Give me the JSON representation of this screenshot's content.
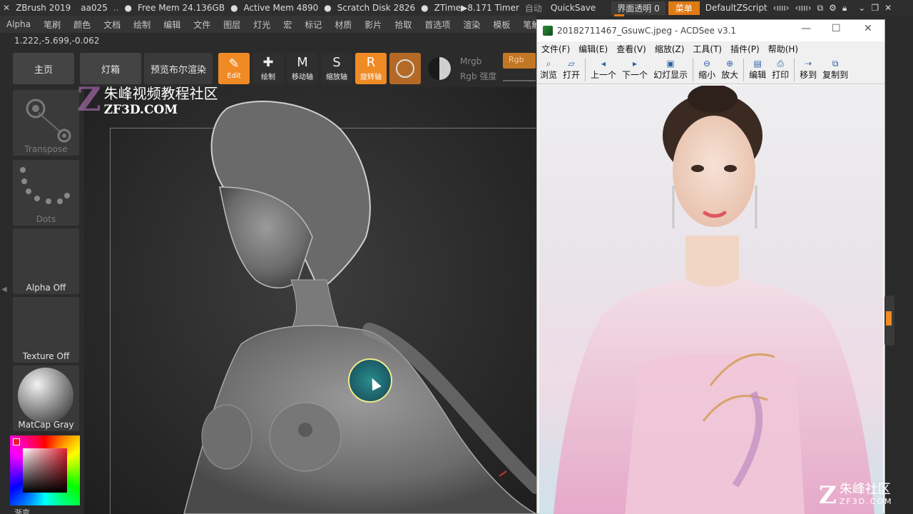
{
  "zbrush": {
    "title_bar": {
      "app": "ZBrush 2019",
      "doc": "aa025",
      "dots": "..",
      "free_mem": "Free Mem 24.136GB",
      "active_mem": "Active Mem 4890",
      "scratch_disk": "Scratch Disk 2826",
      "ztime": "ZTime▶8.171 Timer",
      "auto": "自动",
      "quicksave": "QuickSave",
      "ui_transparency": "界面透明 0",
      "menu_btn": "菜单",
      "script": "DefaultZScript"
    },
    "menu": [
      "Alpha",
      "笔刷",
      "颜色",
      "文档",
      "绘制",
      "编辑",
      "文件",
      "图层",
      "灯光",
      "宏",
      "标记",
      "材质",
      "影片",
      "拾取",
      "首选项",
      "渲染",
      "模板",
      "笔触",
      "纹"
    ],
    "coords": "1.222,-5.699,-0.062",
    "shelf": {
      "home": "主页",
      "lightbox": "灯箱",
      "bpr": "预览布尔渲染"
    },
    "tools": [
      {
        "label": "Edit",
        "icon": "edit-icon",
        "glyph": "✎"
      },
      {
        "label": "绘制",
        "icon": "draw-icon",
        "glyph": "✚"
      },
      {
        "label": "移动轴",
        "icon": "move-icon",
        "glyph": "M"
      },
      {
        "label": "缩放轴",
        "icon": "scale-icon",
        "glyph": "S"
      },
      {
        "label": "旋转轴",
        "icon": "rotate-icon",
        "glyph": "R"
      }
    ],
    "mrgb": "Mrgb",
    "rgb_intensity": "Rgb 强度",
    "rgb": "Rgb",
    "watermark": {
      "logo": "Z",
      "cn": "朱峰视频教程社区",
      "en": "ZF3D.COM"
    },
    "tray": {
      "transpose": "Transpose",
      "dots": "Dots",
      "alpha": "Alpha Off",
      "texture": "Texture Off",
      "matcap": "MatCap Gray",
      "gradient": "渐变"
    }
  },
  "acdsee": {
    "title": "20182711467_GsuwC.jpeg - ACDSee v3.1",
    "min": "—",
    "max": "☐",
    "close": "✕",
    "menu": [
      "文件(F)",
      "编辑(E)",
      "查看(V)",
      "缩放(Z)",
      "工具(T)",
      "插件(P)",
      "帮助(H)"
    ],
    "toolbar": [
      {
        "label": "浏览",
        "icon": "browse-icon",
        "glyph": "⌕"
      },
      {
        "label": "打开",
        "icon": "open-icon",
        "glyph": "▱"
      },
      {
        "label": "上一个",
        "icon": "previous-icon",
        "glyph": "◂"
      },
      {
        "label": "下一个",
        "icon": "next-icon",
        "glyph": "▸"
      },
      {
        "label": "幻灯显示",
        "icon": "slideshow-icon",
        "glyph": "▣"
      },
      {
        "label": "缩小",
        "icon": "zoom-out-icon",
        "glyph": "⊖"
      },
      {
        "label": "放大",
        "icon": "zoom-in-icon",
        "glyph": "⊕"
      },
      {
        "label": "编辑",
        "icon": "edit-image-icon",
        "glyph": "▤"
      },
      {
        "label": "打印",
        "icon": "print-icon",
        "glyph": "⎙"
      },
      {
        "label": "移到",
        "icon": "move-to-icon",
        "glyph": "⇢"
      },
      {
        "label": "复制到",
        "icon": "copy-to-icon",
        "glyph": "⧉"
      }
    ],
    "watermark": {
      "logo": "Z",
      "cn": "朱峰社区",
      "en": "ZF3D.COM"
    }
  },
  "colors": {
    "accent": "#f08a24",
    "cursor_ring": "#f3ea8a"
  }
}
